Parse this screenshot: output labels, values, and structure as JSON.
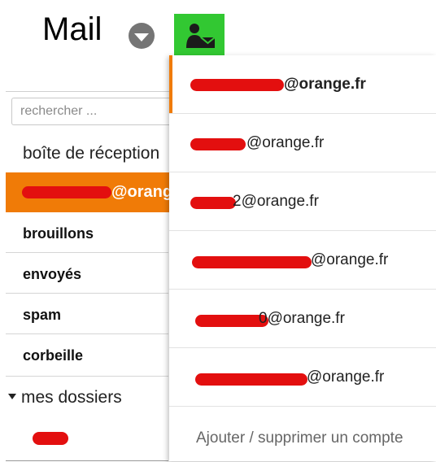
{
  "header": {
    "title": "Mail",
    "dropdown_icon": "chevron-down-icon",
    "account_icon": "account-mail-icon",
    "account_icon_color": "#32c832"
  },
  "sidebar": {
    "search_placeholder": "rechercher ...",
    "inbox_label": "boîte de réception",
    "active_account_suffix": "@orange",
    "folders": [
      "brouillons",
      "envoyés",
      "spam",
      "corbeille"
    ],
    "my_folders_label": "mes dossiers",
    "accent_color": "#f07b07"
  },
  "account_menu": {
    "accounts": [
      {
        "suffix": "@orange.fr"
      },
      {
        "suffix": "@orange.fr"
      },
      {
        "suffix": "2@orange.fr"
      },
      {
        "suffix": "@orange.fr"
      },
      {
        "suffix": "0@orange.fr"
      },
      {
        "suffix": "@orange.fr"
      }
    ],
    "manage_label": "Ajouter / supprimer un compte"
  }
}
